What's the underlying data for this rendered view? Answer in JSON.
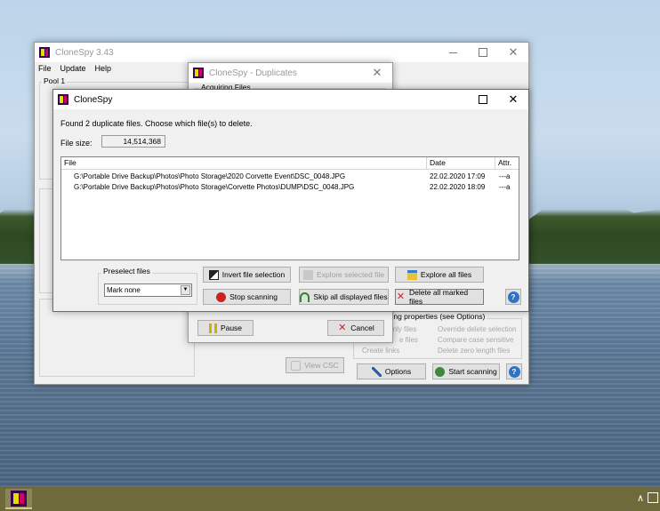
{
  "main_window": {
    "title": "CloneSpy 3.43",
    "menu": [
      "File",
      "Update",
      "Help"
    ],
    "pool_label": "Pool 1",
    "faded_props": [
      "d-only files",
      "Override delete selection",
      "e files",
      "Compare case sensitive",
      "Create links",
      "Delete zero length files"
    ],
    "props_label": "nning properties (see Options)",
    "view_csc": "View CSC",
    "options": "Options",
    "start_scanning": "Start scanning"
  },
  "dup_window": {
    "title": "CloneSpy - Duplicates",
    "acquiring": "Acquiring Files",
    "pause": "Pause",
    "cancel": "Cancel"
  },
  "dialog": {
    "title": "CloneSpy",
    "message": "Found 2 duplicate files. Choose which file(s) to delete.",
    "file_size_label": "File size:",
    "file_size_value": "14,514,368",
    "columns": [
      "File",
      "Date",
      "Attr."
    ],
    "rows": [
      {
        "file": "G:\\Portable Drive Backup\\Photos\\Photo Storage\\2020 Corvette Event\\DSC_0048.JPG",
        "date": "22.02.2020  17:09",
        "attr": "---a"
      },
      {
        "file": "G:\\Portable Drive Backup\\Photos\\Photo Storage\\Corvette Photos\\DUMP\\DSC_0048.JPG",
        "date": "22.02.2020  18:09",
        "attr": "---a"
      }
    ],
    "preselect_label": "Preselect files",
    "preselect_value": "Mark none",
    "invert_selection": "Invert file selection",
    "explore_selected": "Explore selected file",
    "explore_all": "Explore all files",
    "stop_scanning": "Stop scanning",
    "skip_displayed": "Skip all displayed files",
    "delete_marked": "Delete all marked files",
    "help": "?"
  },
  "colors": {
    "accent_blue": "#2f73c4",
    "taskbar": "#6f6a3b"
  }
}
